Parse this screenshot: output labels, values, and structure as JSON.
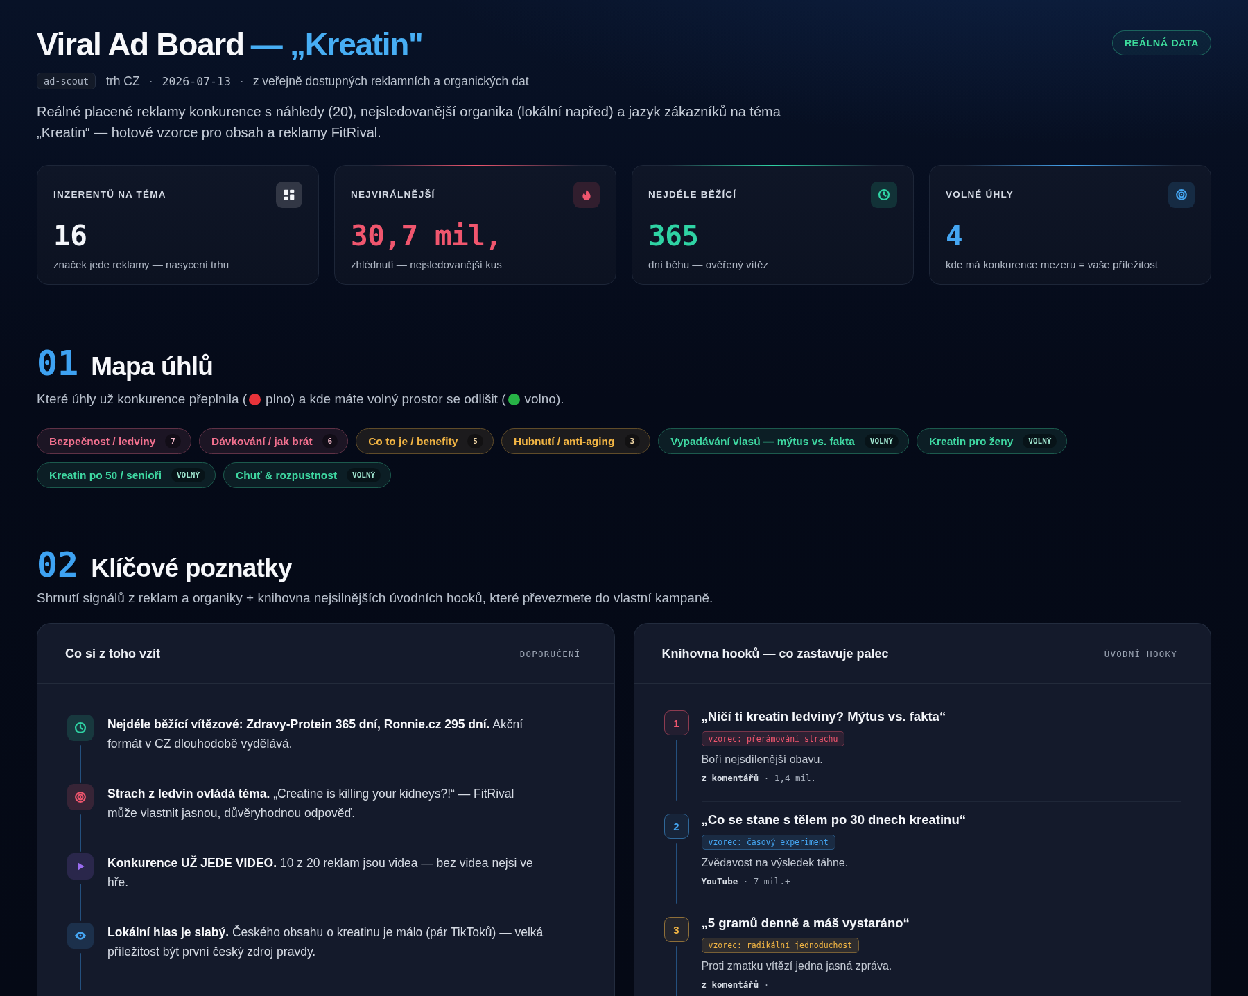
{
  "header": {
    "title": "Viral Ad Board",
    "topic": "— „Kreatin\"",
    "badge": "REÁLNÁ DATA"
  },
  "meta": [
    {
      "kind": "tag",
      "text": "ad-scout"
    },
    {
      "kind": "plain",
      "text": "trh CZ"
    },
    {
      "kind": "separator",
      "text": "·"
    },
    {
      "kind": "mono",
      "text": "2026-07-13"
    },
    {
      "kind": "separator",
      "text": "·"
    },
    {
      "kind": "plain",
      "text": "z veřejně dostupných reklamních a organických dat"
    }
  ],
  "description": "Reálné placené reklamy konkurence s náhledy (20), nejsledovanější organika (lokální napřed) a jazyk zákazníků na téma „Kreatin“ — hotové vzorce pro obsah a reklamy FitRival.",
  "stats": [
    {
      "label": "INZERENTŮ NA TÉMA",
      "value": "16",
      "note": "značek jede reklamy — nasycení trhu",
      "color": "#f4f6fa",
      "accent": false
    },
    {
      "label": "NEJVIRÁLNĚJŠÍ",
      "value": "30,7 mil,",
      "note": "zhlédnutí — nejsledovanější kus",
      "color": "#f0566e",
      "accent": true
    },
    {
      "label": "NEJDÉLE BĚŽÍCÍ",
      "value": "365",
      "note": "dní běhu — ověřený vítěz",
      "color": "#2fd3a4",
      "accent": true
    },
    {
      "label": "VOLNÉ ÚHLY",
      "value": "4",
      "note": "kde má konkurence mezeru = vaše příležitost",
      "color": "#45a6f2",
      "accent": true
    }
  ],
  "angle_map": {
    "number": "01",
    "title": "Mapa úhlů",
    "legend": [
      {
        "kind": "text",
        "text": "Které úhly už konkurence přeplnila ("
      },
      {
        "kind": "dot",
        "color": "#e8333a"
      },
      {
        "kind": "text",
        "text": "plno) a kde máte volný prostor se odlišit ("
      },
      {
        "kind": "dot",
        "color": "#27b346"
      },
      {
        "kind": "text",
        "text": "volno)."
      }
    ],
    "angles": [
      {
        "label": "Bezpečnost / ledviny",
        "badge": "7",
        "color": "#f2718f"
      },
      {
        "label": "Dávkování / jak brát",
        "badge": "6",
        "color": "#f2718f"
      },
      {
        "label": "Co to je / benefity",
        "badge": "5",
        "color": "#f2b544"
      },
      {
        "label": "Hubnutí / anti-aging",
        "badge": "3",
        "color": "#f2b544"
      },
      {
        "label": "Vypadávání vlasů — mýtus vs. fakta",
        "badge": "VOLNÝ",
        "color": "#3fd8a2"
      },
      {
        "label": "Kreatin pro ženy",
        "badge": "VOLNÝ",
        "color": "#3fd8a2"
      },
      {
        "label": "Kreatin po 50 / senioři",
        "badge": "VOLNÝ",
        "color": "#3fd8a2"
      },
      {
        "label": "Chuť & rozpustnost",
        "badge": "VOLNÝ",
        "color": "#3fd8a2"
      }
    ]
  },
  "insights": {
    "number": "02",
    "title": "Klíčové poznatky",
    "subtitle": "Shrnutí signálů z reklam a organiky + knihovna nejsilnějších úvodních hooků, které převezmete do vlastní kampaně.",
    "takeaways": {
      "title": "Co si z toho vzít",
      "tag": "DOPORUČENÍ",
      "items": [
        {
          "text": "**Nejdéle běžící vítězové: Zdravy-Protein 365 dní, Ronnie.cz 295 dní.** Akční formát v CZ dlouhodobě vydělává.",
          "color": "#2fd3a4"
        },
        {
          "text": "**Strach z ledvin ovládá téma.** „Creatine is killing your kidneys?!“ — FitRival může vlastnit jasnou, důvěryhodnou odpověď.",
          "color": "#f0566e"
        },
        {
          "text": "**Konkurence UŽ JEDE VIDEO.** 10 z 20 reklam jsou videa — bez videa nejsi ve hře.",
          "color": "#9b6cf0"
        },
        {
          "text": "**Lokální hlas je slabý.** Českého obsahu o kreatinu je málo (pár TikToků) — velká příležitost být první český zdroj pravdy.",
          "color": "#45a6f2"
        }
      ]
    },
    "hooks": {
      "title": "Knihovna hooků — co zastavuje palec",
      "tag": "ÚVODNÍ HOOKY",
      "items": [
        {
          "number": "1",
          "title": "„Ničí ti kreatin ledviny? Mýtus vs. fakta“",
          "pattern": "vzorec: přerámování strachu",
          "description": "Boří nejsdílenější obavu.",
          "source": "**z komentářů** · 1,4 mil.",
          "color": "#f0566e"
        },
        {
          "number": "2",
          "title": "„Co se stane s tělem po 30 dnech kreatinu“",
          "pattern": "vzorec: časový experiment",
          "description": "Zvědavost na výsledek táhne.",
          "source": "**YouTube** · 7 mil.+",
          "color": "#45a6f2"
        },
        {
          "number": "3",
          "title": "„5 gramů denně a máš vystaráno“",
          "pattern": "vzorec: radikální jednoduchost",
          "description": "Proti zmatku vítězí jedna jasná zpráva.",
          "source": "**z komentářů** ·",
          "color": "#f2b544"
        }
      ]
    }
  }
}
